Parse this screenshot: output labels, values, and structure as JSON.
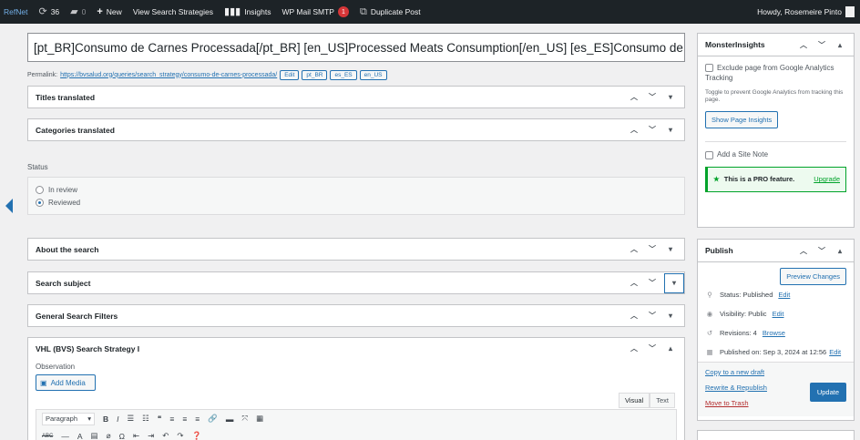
{
  "adminbar": {
    "site": "RefNet",
    "updates": "36",
    "comments": "0",
    "new": "New",
    "view": "View Search Strategies",
    "insights": "Insights",
    "smtp": "WP Mail SMTP",
    "smtp_badge": "1",
    "duplicate": "Duplicate Post",
    "howdy": "Howdy, Rosemeire Pinto"
  },
  "post": {
    "title": "[pt_BR]Consumo de Carnes Processada[/pt_BR] [en_US]Processed Meats Consumption[/en_US] [es_ES]Consumo de Ca",
    "permalink_label": "Permalink:",
    "permalink_url": "https://bvsalud.org/queries/search_strategy/consumo-de-carnes-processada/",
    "permalink_buttons": [
      "Edit",
      "pt_BR",
      "es_ES",
      "en_US"
    ]
  },
  "boxes": {
    "titles": "Titles translated",
    "categories": "Categories translated",
    "about": "About the search",
    "subject": "Search subject",
    "filters": "General Search Filters",
    "vhl": "VHL (BVS) Search Strategy I"
  },
  "status": {
    "label": "Status",
    "options": [
      "In review",
      "Reviewed"
    ],
    "selected": "Reviewed"
  },
  "editor": {
    "observation": "Observation",
    "add_media": "Add Media",
    "tab_visual": "Visual",
    "tab_text": "Text",
    "paragraph": "Paragraph"
  },
  "monsterinsights": {
    "title": "MonsterInsights",
    "exclude_label": "Exclude page from Google Analytics Tracking",
    "toggle_desc": "Toggle to prevent Google Analytics from tracking this page.",
    "show_insights": "Show Page Insights",
    "site_note": "Add a Site Note",
    "pro": "This is a PRO feature.",
    "upgrade": "Upgrade"
  },
  "publish": {
    "title": "Publish",
    "preview": "Preview Changes",
    "status_label": "Status: Published",
    "visibility_label": "Visibility: Public",
    "revisions_label": "Revisions: 4",
    "browse": "Browse",
    "published_label": "Published on: Sep 3, 2024 at 12:56",
    "edit": "Edit",
    "copy_draft": "Copy to a new draft",
    "rewrite": "Rewrite & Republish",
    "trash": "Move to Trash",
    "update": "Update"
  }
}
